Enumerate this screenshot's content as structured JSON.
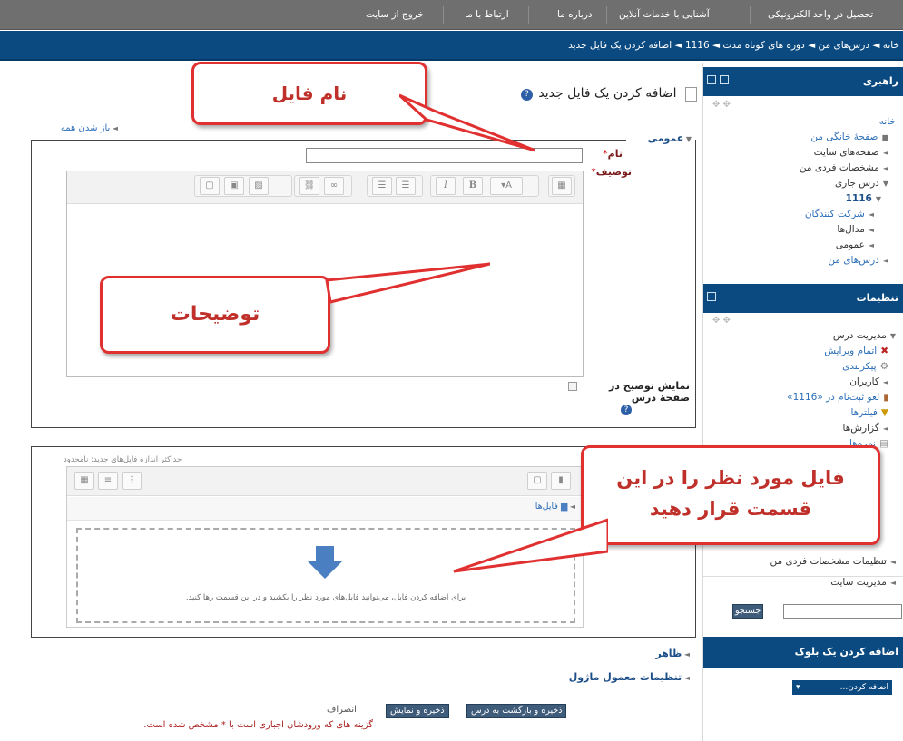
{
  "topnav": {
    "items": [
      "تحصیل در واحد الکترونیکی",
      "آشنایی با خدمات آنلاین",
      "درباره ما",
      "ارتباط با ما",
      "خروج از سایت"
    ]
  },
  "breadcrumb": {
    "text": "خانه ◄ درس‌های من ◄ دوره های کوتاه مدت ◄ 1116 ◄ اضافه کردن یک فایل جدید"
  },
  "sidebar": {
    "nav_block": {
      "title": "راهبری",
      "items": [
        "خانه",
        "صفحهٔ خانگی من",
        "صفحه‌های سایت",
        "مشخصات فردی من",
        "درس جاری",
        "1116",
        "شرکت کنندگان",
        "مدال‌ها",
        "عمومی",
        "درس‌های من"
      ]
    },
    "settings_block": {
      "title": "تنظیمات",
      "items": [
        "مدیریت درس",
        "اتمام ویرایش",
        "پیکربندی",
        "کاربران",
        "لغو ثبت‌نام در «1116»",
        "فیلترها",
        "گزارش‌ها",
        "نمره‌ها",
        "تنظیمات مشخصات فردی من",
        "مدیریت سایت"
      ]
    },
    "search_button": "جستجو",
    "add_block": {
      "title": "اضافه کردن یک بلوک",
      "select_value": "اضافه کردن..."
    }
  },
  "main": {
    "title": "اضافه کردن یک فایل جدید",
    "expand_all": "باز شدن همه",
    "general_legend": "عمومی",
    "name_label": "نام",
    "description_label": "توصیف",
    "show_description_label": "نمایش توصیح در صفحهٔ درس",
    "max_size_note": "حداکثر اندازه فایل‌های جدید: نامحدود",
    "files_path": "فایل‌ها",
    "drop_hint": "برای اضافه کردن فایل، می‌توانید فایل‌های مورد نظر را بکشید و در این قسمت رها کنید.",
    "appearance_legend": "ظاهر",
    "common_settings_legend": "تنظیمات معمول ماژول",
    "btn_save_return": "ذخیره و بازگشت به درس",
    "btn_save_display": "ذخیره و نمایش",
    "btn_cancel": "انصراف",
    "required_note": "گزینه های که ورودشان اجباری است با * مشخص شده است."
  },
  "callouts": {
    "file_name": "نام فایل",
    "description": "توضیحات",
    "file_place": "فایل مورد نظر را در این قسمت قرار دهید"
  },
  "colors": {
    "topnav": "#6f6f6f",
    "header_blue": "#0b4a80",
    "callout_border": "#e03030",
    "callout_text": "#c0302a"
  }
}
